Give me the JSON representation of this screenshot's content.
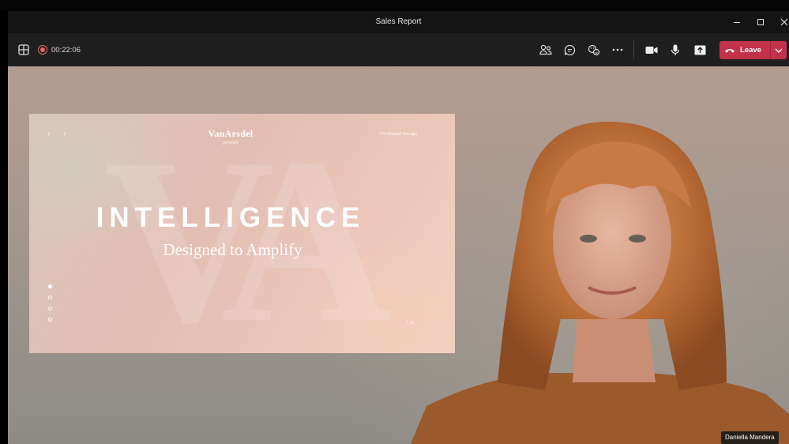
{
  "window": {
    "title": "Sales Report"
  },
  "toolbar": {
    "recording_time": "00:22:06",
    "leave_label": "Leave",
    "icons": [
      "layout-grid-icon",
      "recording-icon",
      "people-icon",
      "chat-icon",
      "reactions-icon",
      "more-icon",
      "camera-icon",
      "mic-icon",
      "share-icon",
      "phone-hangup-icon",
      "chevron-down-icon"
    ]
  },
  "slide": {
    "logo": "VanArsdel",
    "logo_sub": "presents",
    "corner_text": "VA Shared Design",
    "title": "INTELLIGENCE",
    "subtitle": "Designed to Amplify",
    "page": "1 of",
    "dots_count": 4,
    "active_dot": 1
  },
  "participant": {
    "name": "Daniella Mandera"
  },
  "colors": {
    "leave_button": "#c4314b",
    "titlebar": "#141414",
    "toolbar": "#1f1f1f",
    "recording": "#e06a6a"
  }
}
